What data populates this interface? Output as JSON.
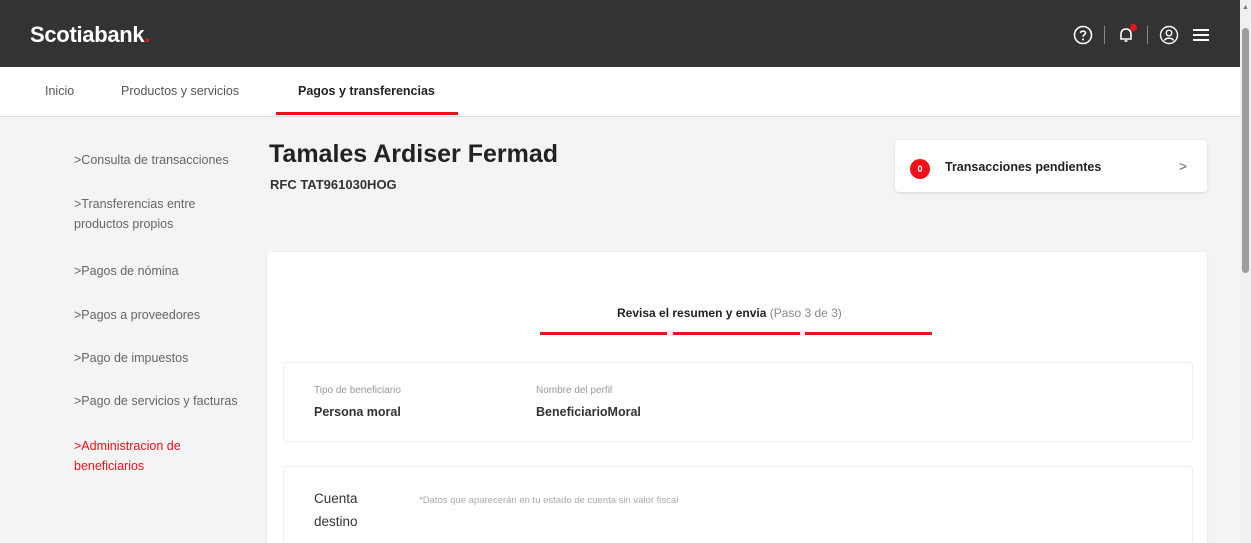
{
  "header": {
    "brand": "Scotiabank",
    "brand_dot": ".",
    "icons": [
      "help-icon",
      "notifications-icon",
      "profile-icon",
      "menu-icon"
    ]
  },
  "nav": {
    "items": [
      {
        "label": "Inicio"
      },
      {
        "label": "Productos y servicios"
      },
      {
        "label": "Pagos y transferencias",
        "active": true
      }
    ]
  },
  "sidebar": {
    "items": [
      {
        "label": ">Consulta de transacciones"
      },
      {
        "label": ">Transferencias entre productos propios"
      },
      {
        "label": ">Pagos de nómina"
      },
      {
        "label": ">Pagos a proveedores"
      },
      {
        "label": ">Pago de impuestos"
      },
      {
        "label": ">Pago de servicios y facturas"
      },
      {
        "label": ">Administracion de beneficiarios",
        "active": true
      }
    ]
  },
  "page": {
    "title": "Tamales Ardiser Fermad",
    "rfc": "RFC TAT961030HOG"
  },
  "pending": {
    "count": "0",
    "label": "Transacciones pendientes",
    "chevron": ">"
  },
  "summary": {
    "step_title": "Revisa el resumen y envia",
    "step_hint": "(Paso 3 de 3)",
    "fields": {
      "tipo_label": "Tipo de beneficiario",
      "tipo_value": "Persona moral",
      "perfil_label": "Nombre del perfil",
      "perfil_value": "BeneficiarioMoral"
    },
    "destino": {
      "title": "Cuenta destino",
      "note": "*Datos que aparecerán en tu estado de cuenta sin valor fiscal"
    }
  },
  "colors": {
    "brand_red": "#ec111a",
    "topbar": "#333333"
  }
}
